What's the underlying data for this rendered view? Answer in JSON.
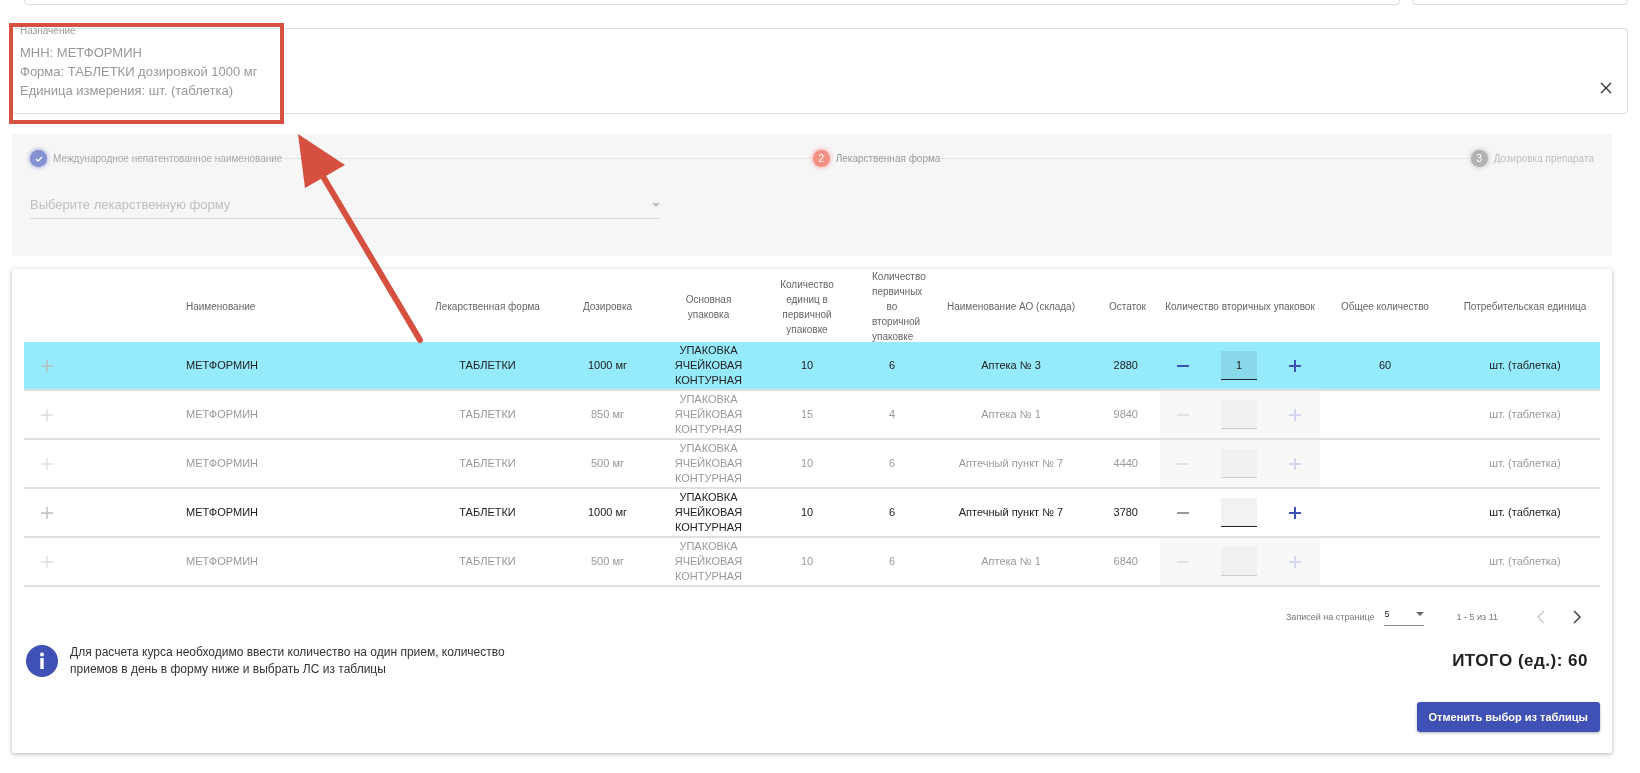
{
  "prescription": {
    "label": "Назначение",
    "lines": [
      "МНН: МЕТФОРМИН",
      "Форма: ТАБЛЕТКИ дозировкой 1000 мг",
      "Единица измерения: шт. (таблетка)"
    ]
  },
  "stepper": {
    "steps": [
      {
        "label": "Международное непатентованное наименование",
        "completed": true,
        "selected": false
      },
      {
        "number": "2",
        "label": "Лекарственная форма",
        "completed": false,
        "selected": true
      },
      {
        "number": "3",
        "label": "Дозировка препарата",
        "completed": false,
        "selected": false
      }
    ],
    "select": {
      "placeholder": "Выберите лекарственную форму"
    }
  },
  "table": {
    "columns": [
      "Наименование",
      "Лекарственная форма",
      "Дозировка",
      "Основная упаковка",
      "Количество единиц в первичной упаковке",
      "Количество первичных во вторичной упаковке",
      "Наименование АО (склада)",
      "Остаток",
      "Количество вторичных упаковок",
      "Общее количество",
      "Потребительская единица"
    ],
    "rows": [
      {
        "selected": true,
        "disabled": false,
        "name": "МЕТФОРМИН",
        "form": "ТАБЛЕТКИ",
        "dose": "1000 мг",
        "pack": "УПАКОВКА ЯЧЕЙКОВАЯ КОНТУРНАЯ",
        "units_in_primary": "10",
        "primary_in_secondary": "6",
        "warehouse": "Аптека № 3",
        "stock": "2880",
        "quantity": "1",
        "total": "60",
        "unit": "шт. (таблетка)"
      },
      {
        "selected": false,
        "disabled": true,
        "name": "МЕТФОРМИН",
        "form": "ТАБЛЕТКИ",
        "dose": "850 мг",
        "pack": "УПАКОВКА ЯЧЕЙКОВАЯ КОНТУРНАЯ",
        "units_in_primary": "15",
        "primary_in_secondary": "4",
        "warehouse": "Аптека № 1",
        "stock": "9840",
        "unit": "шт. (таблетка)"
      },
      {
        "selected": false,
        "disabled": true,
        "name": "МЕТФОРМИН",
        "form": "ТАБЛЕТКИ",
        "dose": "500 мг",
        "pack": "УПАКОВКА ЯЧЕЙКОВАЯ КОНТУРНАЯ",
        "units_in_primary": "10",
        "primary_in_secondary": "6",
        "warehouse": "Аптечный пункт № 7",
        "stock": "4440",
        "unit": "шт. (таблетка)"
      },
      {
        "selected": false,
        "disabled": false,
        "name": "МЕТФОРМИН",
        "form": "ТАБЛЕТКИ",
        "dose": "1000 мг",
        "pack": "УПАКОВКА ЯЧЕЙКОВАЯ КОНТУРНАЯ",
        "units_in_primary": "10",
        "primary_in_secondary": "6",
        "warehouse": "Аптечный пункт № 7",
        "stock": "3780",
        "unit": "шт. (таблетка)"
      },
      {
        "selected": false,
        "disabled": true,
        "name": "МЕТФОРМИН",
        "form": "ТАБЛЕТКИ",
        "dose": "500 мг",
        "pack": "УПАКОВКА ЯЧЕЙКОВАЯ КОНТУРНАЯ",
        "units_in_primary": "10",
        "primary_in_secondary": "6",
        "warehouse": "Аптека № 1",
        "stock": "6840",
        "unit": "шт. (таблетка)"
      }
    ]
  },
  "pagination": {
    "rows_per_page_label": "Записей на странице",
    "rows_per_page": "5",
    "range": "1 - 5 из 11"
  },
  "info": "Для расчета курса необходимо ввести количество на один прием, количество приемов в день в форму ниже и выбрать ЛС из таблицы",
  "total": "ИТОГО (ед.): 60",
  "button": "Отменить выбор из таблицы"
}
